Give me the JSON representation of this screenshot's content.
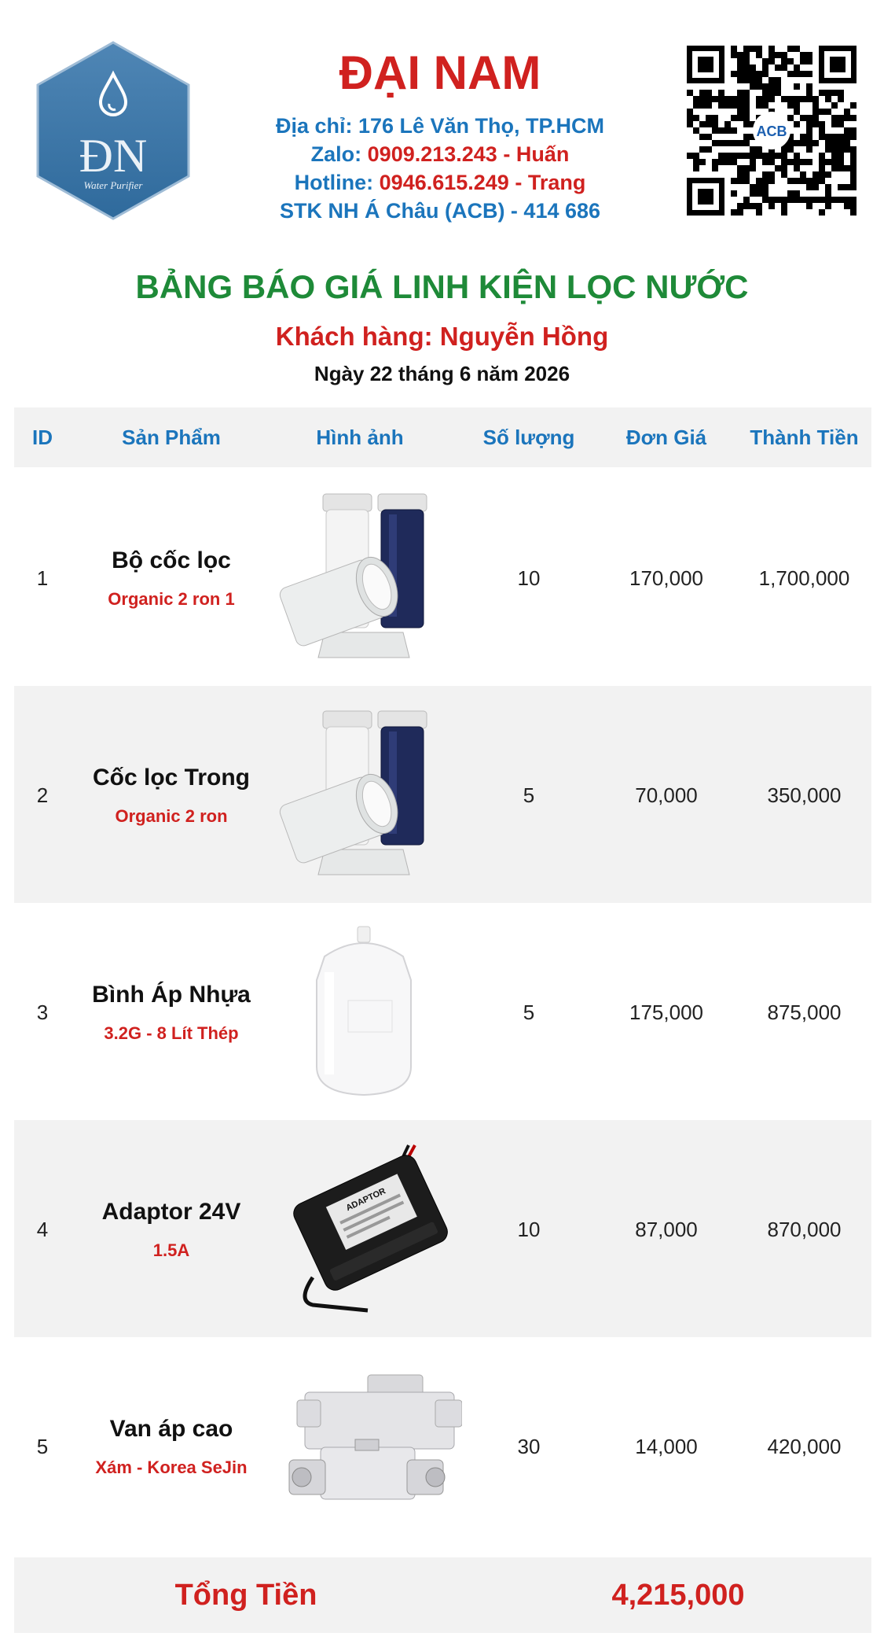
{
  "header": {
    "logo_text": "ĐN",
    "logo_sub": "Water Purifier",
    "brand": "ĐẠI NAM",
    "address_label": "Địa chỉ: 176 Lê Văn Thọ, TP.HCM",
    "zalo_label": "Zalo: ",
    "zalo_value": "0909.213.243 - Huấn",
    "hotline_label": "Hotline: ",
    "hotline_value": "0946.615.249 - Trang",
    "bank_label": "STK NH Á Châu (ACB) - 414 686",
    "qr_badge": "ACB"
  },
  "title": "BẢNG BÁO GIÁ LINH KIỆN LỌC NƯỚC",
  "customer": "Khách hàng: Nguyễn Hồng",
  "date": "Ngày 22 tháng 6 năm 2026",
  "table": {
    "headers": [
      "ID",
      "Sản Phẩm",
      "Hình ảnh",
      "Số lượng",
      "Đơn Giá",
      "Thành Tiền"
    ],
    "rows": [
      {
        "id": "1",
        "name": "Bộ cốc lọc",
        "sub": "Organic 2 ron 1",
        "image": "filter-housing",
        "qty": "10",
        "price": "170,000",
        "total": "1,700,000"
      },
      {
        "id": "2",
        "name": "Cốc lọc Trong",
        "sub": "Organic 2 ron",
        "image": "filter-housing",
        "qty": "5",
        "price": "70,000",
        "total": "350,000"
      },
      {
        "id": "3",
        "name": "Bình Áp Nhựa",
        "sub": "3.2G - 8 Lít Thép",
        "image": "pressure-tank",
        "qty": "5",
        "price": "175,000",
        "total": "875,000"
      },
      {
        "id": "4",
        "name": "Adaptor 24V",
        "sub": "1.5A",
        "image": "power-adaptor",
        "qty": "10",
        "price": "87,000",
        "total": "870,000"
      },
      {
        "id": "5",
        "name": "Van áp cao",
        "sub": "Xám - Korea SeJin",
        "image": "high-pressure-valve",
        "qty": "30",
        "price": "14,000",
        "total": "420,000"
      }
    ]
  },
  "adaptor_label": "ADAPTOR",
  "total_label": "Tổng Tiền",
  "total_value": "4,215,000",
  "colors": {
    "brand_red": "#d0211f",
    "info_blue": "#1b75bc",
    "title_green": "#1e8a38",
    "row_alt": "#f2f2f2"
  }
}
